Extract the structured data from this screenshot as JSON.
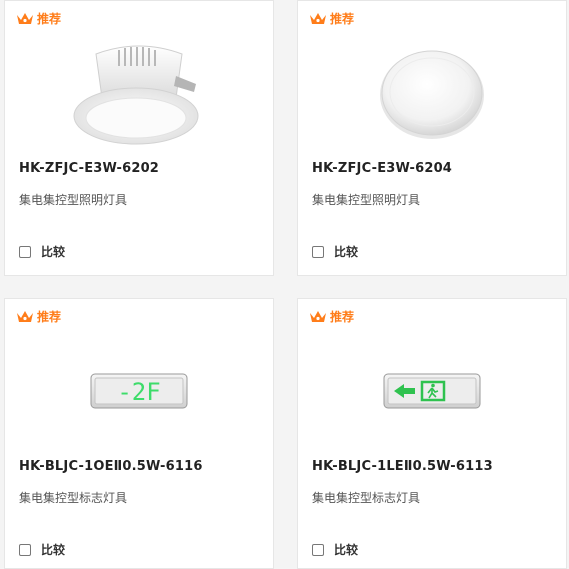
{
  "products": [
    {
      "badge": "推荐",
      "model": "HK-ZFJC-E3W-6202",
      "category": "集电集控型照明灯具",
      "compare_label": "比较",
      "image_icon": "downlight-icon"
    },
    {
      "badge": "推荐",
      "model": "HK-ZFJC-E3W-6204",
      "category": "集电集控型照明灯具",
      "compare_label": "比较",
      "image_icon": "ceiling-light-icon"
    },
    {
      "badge": "推荐",
      "model": "HK-BLJC-1OEⅡ0.5W-6116",
      "category": "集电集控型标志灯具",
      "compare_label": "比较",
      "image_icon": "floor-sign-icon",
      "sign_text": "-2F"
    },
    {
      "badge": "推荐",
      "model": "HK-BLJC-1LEⅡ0.5W-6113",
      "category": "集电集控型标志灯具",
      "compare_label": "比较",
      "image_icon": "exit-sign-icon"
    }
  ],
  "colors": {
    "badge": "#ff7d1a",
    "sign_green": "#3ddc6a"
  }
}
